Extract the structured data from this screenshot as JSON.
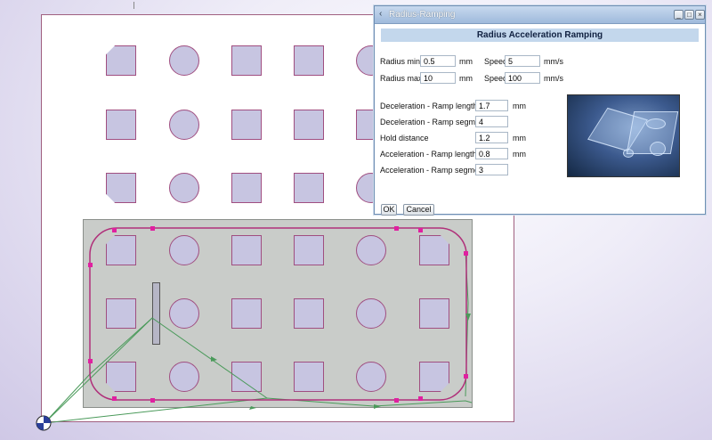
{
  "dialog": {
    "title": "Radius-Ramping",
    "header": "Radius Acceleration Ramping",
    "radius_min": {
      "label": "Radius min.",
      "value": "0.5",
      "unit": "mm"
    },
    "radius_max": {
      "label": "Radius max.",
      "value": "10",
      "unit": "mm"
    },
    "speed_1": {
      "label": "Speed",
      "value": "5",
      "unit": "mm/s"
    },
    "speed_2": {
      "label": "Speed",
      "value": "100",
      "unit": "mm/s"
    },
    "decel_length": {
      "label": "Deceleration - Ramp length",
      "value": "1.7",
      "unit": "mm"
    },
    "decel_segments": {
      "label": "Deceleration - Ramp segments",
      "value": "4"
    },
    "hold_distance": {
      "label": "Hold distance",
      "value": "1.2",
      "unit": "mm"
    },
    "accel_length": {
      "label": "Acceleration - Ramp length",
      "value": "0.8",
      "unit": "mm"
    },
    "accel_segments": {
      "label": "Acceleration - Ramp segments",
      "value": "3"
    },
    "ok_label": "OK",
    "cancel_label": "Cancel",
    "preview_image": "glass-parts-photo"
  },
  "canvas": {
    "part_color": "#c7c5e1",
    "outline_color": "#a04e80",
    "path_color": "#4a9a5a",
    "handle_color": "#e020a0"
  },
  "icons": {
    "title": "dialog-icon",
    "minimize": "minimize-icon",
    "maximize": "maximize-icon",
    "close": "close-icon",
    "origin": "origin-icon"
  }
}
